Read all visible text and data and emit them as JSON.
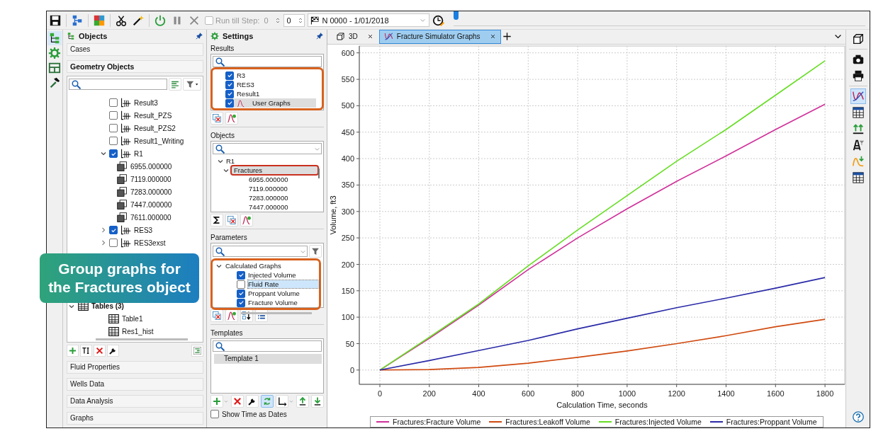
{
  "toolbar": {
    "run_till_step": {
      "label": "Run till Step:",
      "value": "0",
      "disabled": true
    },
    "step": {
      "value": "0"
    },
    "date_combo": {
      "value": "N 0000 - 1/01/2018"
    },
    "timeline": {
      "level": 0
    }
  },
  "objects_panel": {
    "title": "Objects",
    "sections": [
      {
        "title": "Cases",
        "expanded": false
      },
      {
        "title": "Geometry Objects",
        "expanded": true,
        "tree": [
          {
            "label": "Result3",
            "kind": "result",
            "checked": false
          },
          {
            "label": "Result_PZS",
            "kind": "result",
            "checked": false
          },
          {
            "label": "Result_PZS2",
            "kind": "result",
            "checked": false
          },
          {
            "label": "Result1_Writing",
            "kind": "result",
            "checked": false
          },
          {
            "label": "R1",
            "kind": "result",
            "checked": true,
            "expanded": true,
            "children": [
              {
                "label": "6955.000000",
                "kind": "layer"
              },
              {
                "label": "7119.000000",
                "kind": "layer"
              },
              {
                "label": "7283.000000",
                "kind": "layer"
              },
              {
                "label": "7447.000000",
                "kind": "layer"
              },
              {
                "label": "7611.000000",
                "kind": "layer"
              }
            ]
          },
          {
            "label": "RES3",
            "kind": "result",
            "checked": true,
            "expanded": false
          },
          {
            "label": "RES3exst",
            "kind": "result",
            "checked": false,
            "expanded": false
          },
          {
            "label": "Tables (3)",
            "kind": "folder",
            "expanded": true,
            "children": [
              {
                "label": "Table1",
                "kind": "table"
              },
              {
                "label": "Res1_hist",
                "kind": "table"
              }
            ]
          }
        ]
      },
      {
        "title": "Fluid Properties",
        "expanded": false
      },
      {
        "title": "Wells Data",
        "expanded": false
      },
      {
        "title": "Data Analysis",
        "expanded": false
      },
      {
        "title": "Graphs",
        "expanded": false
      }
    ]
  },
  "settings_panel": {
    "title": "Settings",
    "results": {
      "title": "Results",
      "highlighted": true,
      "items": [
        {
          "label": "R3",
          "checked": true,
          "selected": false,
          "kind": "plain"
        },
        {
          "label": "RES3",
          "checked": true,
          "selected": false,
          "kind": "plain"
        },
        {
          "label": "Result1",
          "checked": true,
          "selected": false,
          "kind": "plain"
        },
        {
          "label": "User Graphs",
          "checked": true,
          "selected": true,
          "kind": "graph"
        }
      ]
    },
    "objects": {
      "title": "Objects",
      "tree": [
        {
          "label": "R1",
          "expanded": true,
          "selected": false,
          "children": [
            {
              "label": "Fractures",
              "expanded": true,
              "selected": true,
              "highlighted": true,
              "children": [
                {
                  "label": "6955.000000",
                  "selected": false
                },
                {
                  "label": "7119.000000",
                  "selected": false
                },
                {
                  "label": "7283.000000",
                  "selected": false
                },
                {
                  "label": "7447.000000",
                  "selected": false
                }
              ]
            }
          ]
        }
      ]
    },
    "parameters": {
      "title": "Parameters",
      "highlighted": true,
      "tree": [
        {
          "label": "Calculated Graphs",
          "expanded": true,
          "children": [
            {
              "label": "Injected Volume",
              "checked": true,
              "selected": false
            },
            {
              "label": "Fluid Rate",
              "checked": false,
              "selected": true
            },
            {
              "label": "Proppant Volume",
              "checked": true,
              "selected": false
            },
            {
              "label": "Fracture Volume",
              "checked": true,
              "selected": false
            }
          ]
        }
      ]
    },
    "templates": {
      "title": "Templates",
      "items": [
        {
          "label": "Template 1",
          "selected": true
        }
      ]
    },
    "show_time_as_dates": {
      "label": "Show Time as Dates",
      "checked": false
    }
  },
  "tabs": [
    {
      "label": "3D",
      "kind": "box",
      "selected": false
    },
    {
      "label": "Fracture Simulator Graphs",
      "kind": "graph",
      "selected": true
    }
  ],
  "chart": {
    "chart_data": {
      "type": "line",
      "grid": true,
      "xlabel": "Calculation Time, seconds",
      "ylabel": "Volume, ft3",
      "x": [
        0,
        200,
        400,
        600,
        800,
        1000,
        1200,
        1400,
        1600,
        1800
      ],
      "xticks": [
        0,
        200,
        400,
        600,
        800,
        1000,
        1200,
        1400,
        1600,
        1800
      ],
      "yticks": [
        0,
        50,
        100,
        150,
        200,
        250,
        300,
        350,
        400,
        450,
        500,
        550,
        600
      ],
      "xlim": [
        -83,
        1880
      ],
      "ylim": [
        -27,
        613
      ],
      "series": [
        {
          "name": "Fractures:Fracture Volume",
          "color": "#d0309a",
          "values": [
            0,
            60,
            123,
            190,
            250,
            305,
            357,
            405,
            455,
            503
          ]
        },
        {
          "name": "Fractures:Leakoff Volume",
          "color": "#d04a10",
          "values": [
            0,
            1,
            5,
            13,
            24,
            36,
            50,
            65,
            82,
            96
          ]
        },
        {
          "name": "Fractures:Injected Volume",
          "color": "#66dd22",
          "values": [
            0,
            62,
            125,
            197,
            265,
            330,
            395,
            455,
            520,
            585
          ]
        },
        {
          "name": "Fractures:Proppant Volume",
          "color": "#2a2aa8",
          "values": [
            0,
            18,
            37,
            56,
            78,
            98,
            118,
            136,
            155,
            175
          ]
        }
      ]
    }
  },
  "callout": {
    "text": "Group graphs for the Fractures object"
  }
}
